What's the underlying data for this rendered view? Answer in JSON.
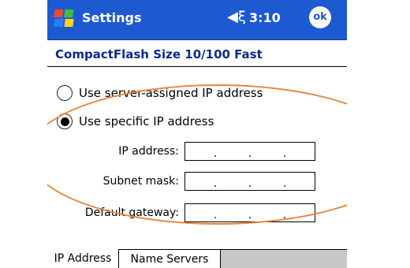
{
  "titlebar": {
    "title": "Settings",
    "time": "3:10",
    "speaker_glyph": "◀ξ",
    "ok_label": "ok",
    "start_icon": "windows-flag-icon"
  },
  "header": {
    "title": "CompactFlash Size 10/100 Fast"
  },
  "options": {
    "server_assigned": {
      "label": "Use server-assigned IP address",
      "selected": false
    },
    "specific": {
      "label": "Use specific IP address",
      "selected": true
    }
  },
  "fields": {
    "ip_address": {
      "label": "IP address:"
    },
    "subnet_mask": {
      "label": "Subnet mask:"
    },
    "default_gateway": {
      "label": "Default gateway:"
    }
  },
  "ip_separator": ".",
  "tabs": [
    {
      "label": "IP Address",
      "active": true
    },
    {
      "label": "Name Servers",
      "active": false
    }
  ],
  "colors": {
    "titlebar": "#1d5ad1",
    "header_text": "#0a2a8a",
    "highlight_ellipse": "#e8853a",
    "tab_strip": "#c8c8c8"
  }
}
